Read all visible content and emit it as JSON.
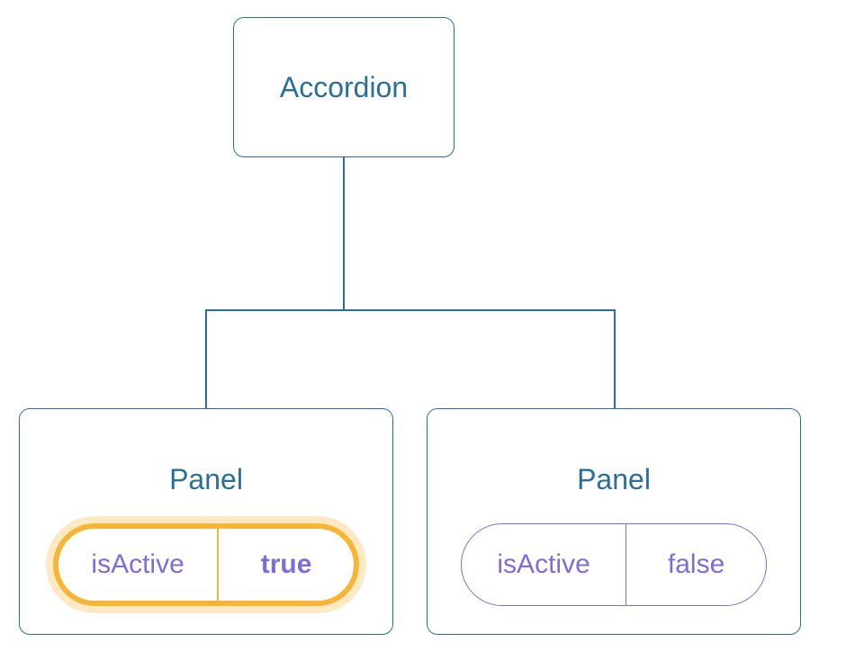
{
  "root": {
    "label": "Accordion"
  },
  "panels": [
    {
      "label": "Panel",
      "prop_name": "isActive",
      "prop_value": "true",
      "active": true
    },
    {
      "label": "Panel",
      "prop_name": "isActive",
      "prop_value": "false",
      "active": false
    }
  ]
}
